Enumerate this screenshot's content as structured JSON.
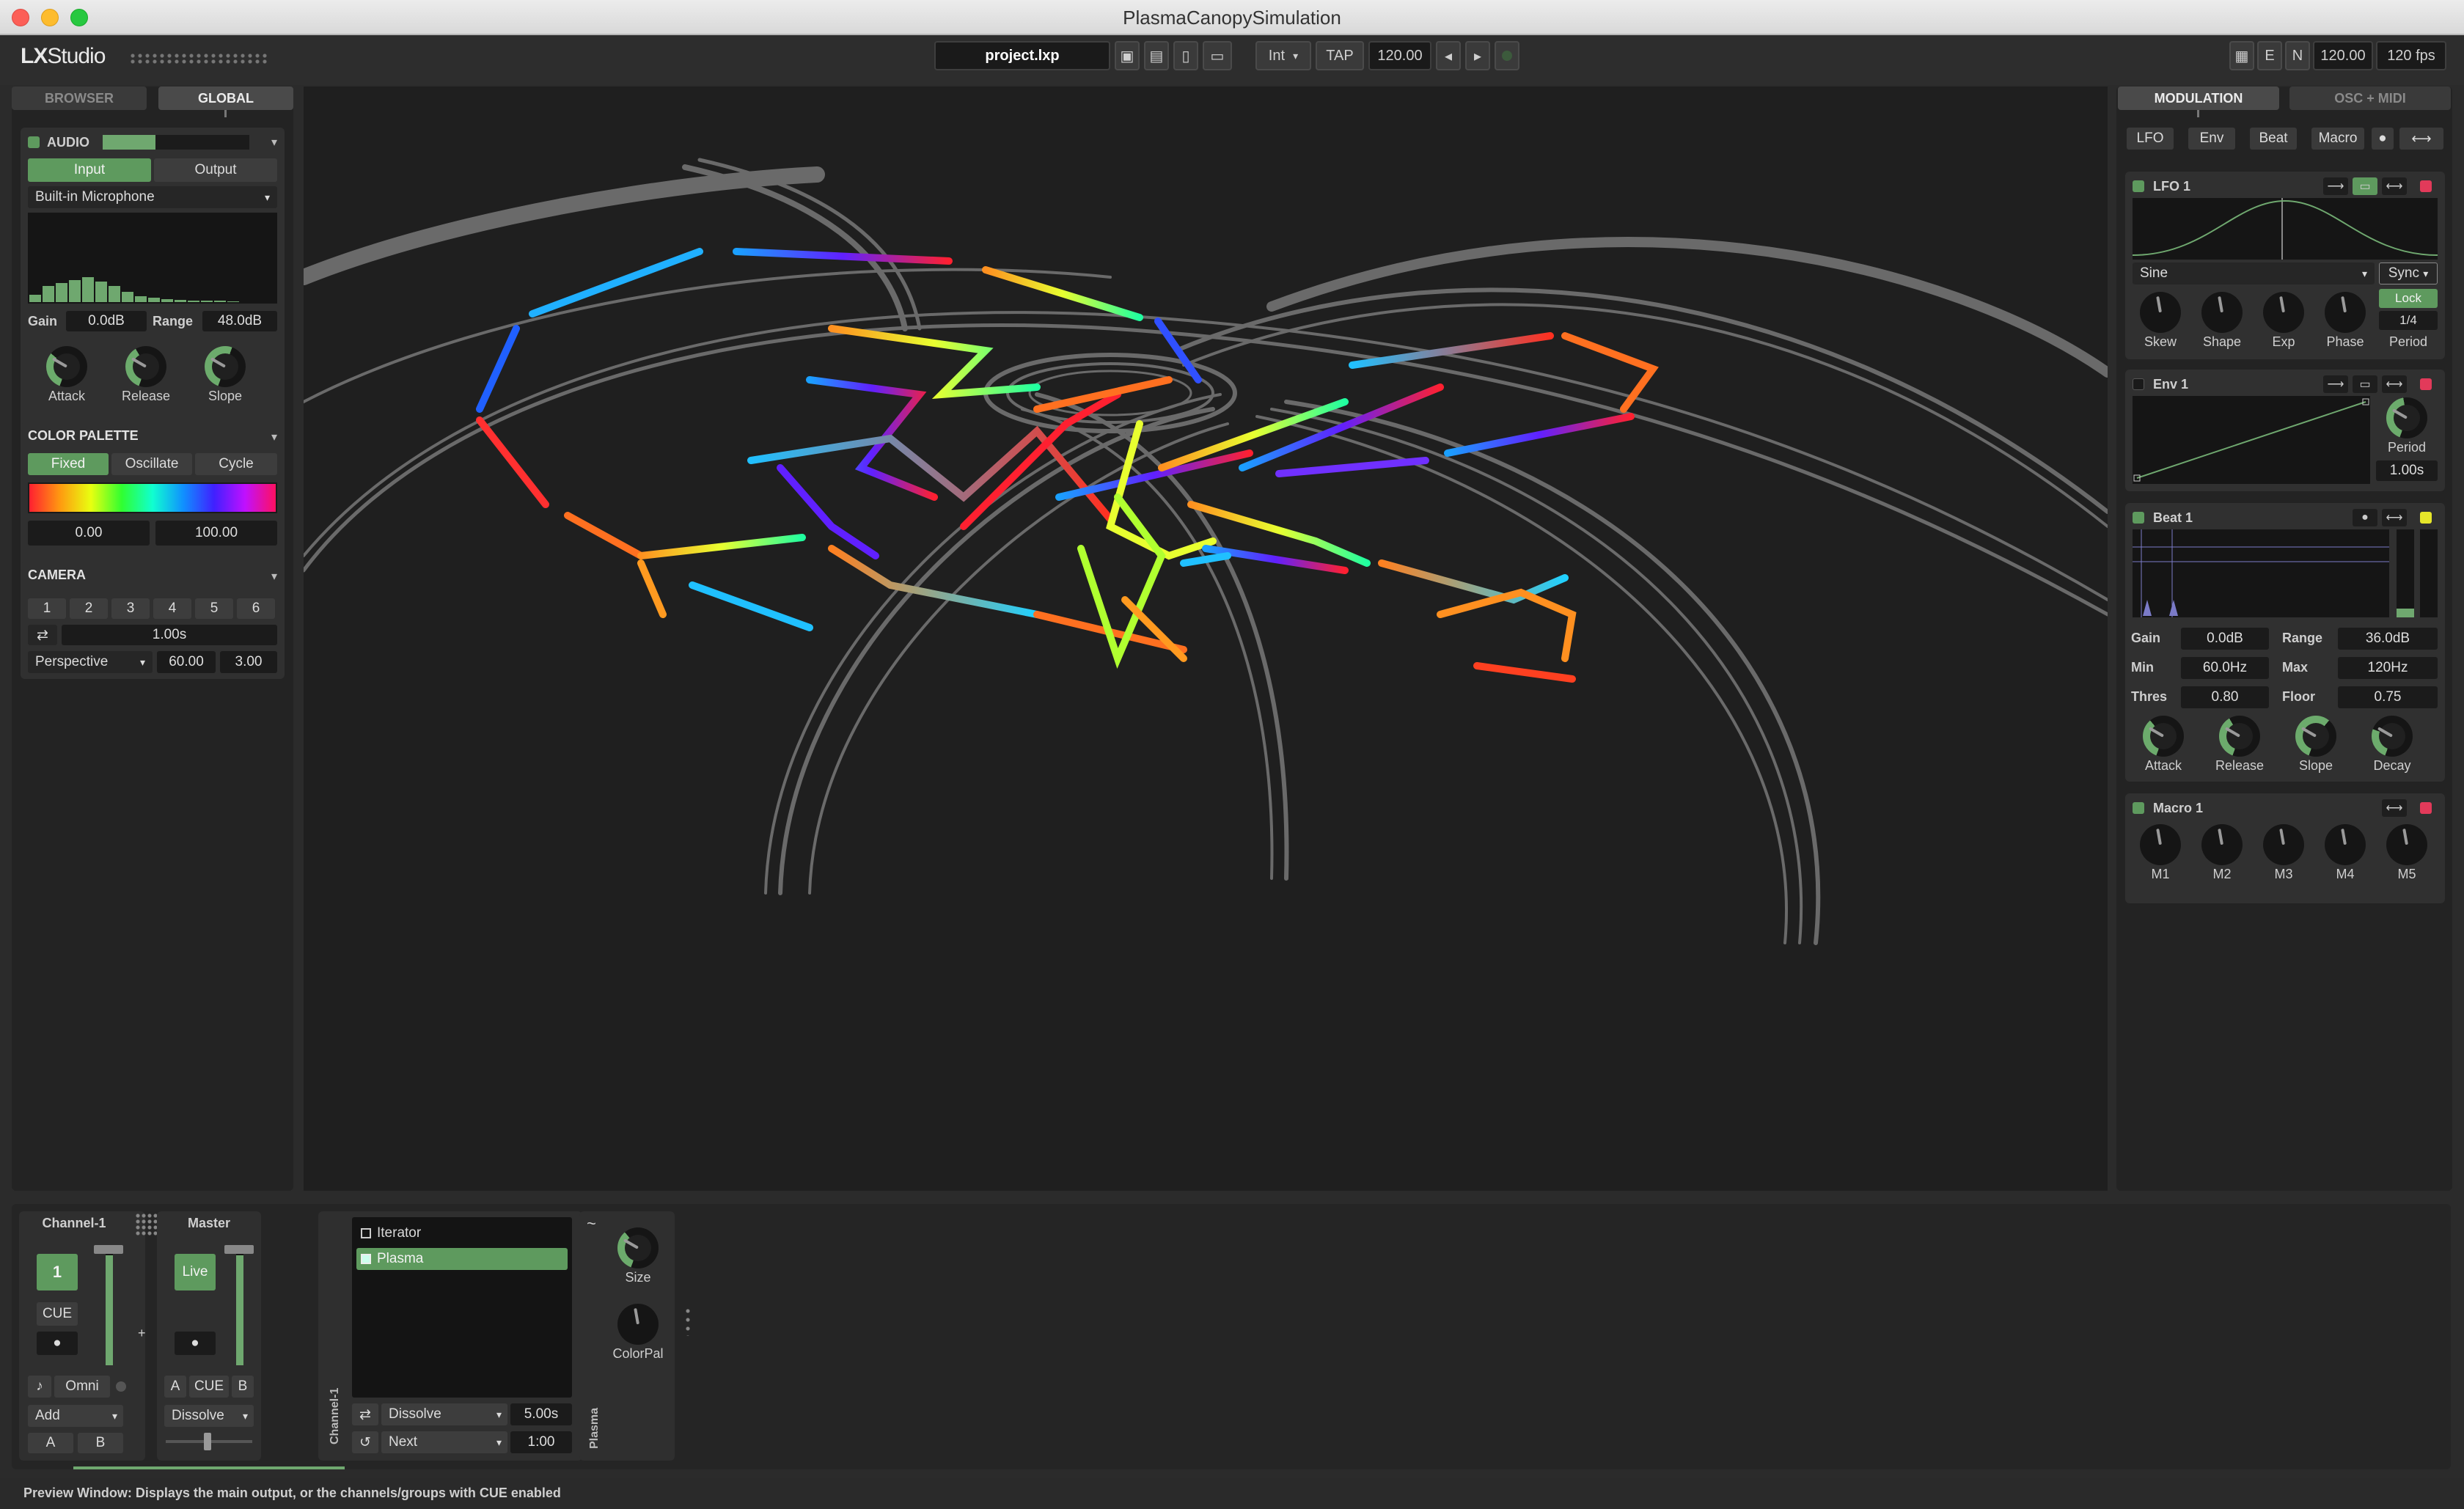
{
  "window": {
    "title": "PlasmaCanopySimulation"
  },
  "topbar": {
    "logo_lx": "LX",
    "logo_studio": "Studio",
    "project": "project.lxp",
    "clock_mode": "Int",
    "tap": "TAP",
    "bpm": "120.00",
    "prev": "◂",
    "next": "▸",
    "right_e": "E",
    "right_n": "N",
    "right_bpm": "120.00",
    "fps": "120 fps"
  },
  "left": {
    "tabs": [
      "BROWSER",
      "GLOBAL"
    ],
    "audio": {
      "title": "AUDIO",
      "input": "Input",
      "output": "Output",
      "device": "Built-in Microphone",
      "gain_label": "Gain",
      "gain": "0.0dB",
      "range_label": "Range",
      "range": "48.0dB",
      "knobs": [
        "Attack",
        "Release",
        "Slope"
      ]
    },
    "palette": {
      "title": "COLOR PALETTE",
      "modes": [
        "Fixed",
        "Oscillate",
        "Cycle"
      ],
      "min": "0.00",
      "max": "100.00"
    },
    "camera": {
      "title": "CAMERA",
      "presets": [
        "1",
        "2",
        "3",
        "4",
        "5",
        "6"
      ],
      "duration": "1.00s",
      "projection": "Perspective",
      "fov": "60.00",
      "depth": "3.00"
    }
  },
  "right": {
    "tabs": [
      "MODULATION",
      "OSC + MIDI"
    ],
    "mod_buttons": [
      "LFO",
      "Env",
      "Beat",
      "Macro"
    ],
    "lfo": {
      "title": "LFO 1",
      "wave": "Sine",
      "sync": "Sync",
      "lock": "Lock",
      "fraction": "1/4",
      "knobs": [
        "Skew",
        "Shape",
        "Exp",
        "Phase",
        "Period"
      ]
    },
    "env": {
      "title": "Env 1",
      "period_label": "Period",
      "period": "1.00s"
    },
    "beat": {
      "title": "Beat 1",
      "rows": [
        {
          "l1": "Gain",
          "v1": "0.0dB",
          "l2": "Range",
          "v2": "36.0dB"
        },
        {
          "l1": "Min",
          "v1": "60.0Hz",
          "l2": "Max",
          "v2": "120Hz"
        },
        {
          "l1": "Thres",
          "v1": "0.80",
          "l2": "Floor",
          "v2": "0.75"
        }
      ],
      "knobs": [
        "Attack",
        "Release",
        "Slope",
        "Decay"
      ]
    },
    "macro": {
      "title": "Macro 1",
      "knobs": [
        "M1",
        "M2",
        "M3",
        "M4",
        "M5"
      ]
    }
  },
  "mixer": {
    "channel_title": "Channel-1",
    "master_title": "Master",
    "channel_num": "1",
    "cue": "CUE",
    "live": "Live",
    "omni": "Omni",
    "blend": "Add",
    "ab_a": "A",
    "ab_b": "B",
    "master_a": "A",
    "master_cue": "CUE",
    "master_b": "B",
    "crossfade": "Dissolve",
    "patterns": [
      "Iterator",
      "Plasma"
    ],
    "transition": "Dissolve",
    "transition_time": "5.00s",
    "playlist": "Next",
    "playlist_time": "1:00",
    "vertical_channel": "Channel-1",
    "vertical_pattern": "Plasma",
    "device_knobs": [
      "Size",
      "ColorPal"
    ]
  },
  "status": {
    "text": "Preview Window: Displays the main output, or the channels/groups with CUE enabled"
  },
  "colors": {
    "accent": "#5e9a5e",
    "panel": "#232323",
    "viewport": "#1f1f1f"
  }
}
